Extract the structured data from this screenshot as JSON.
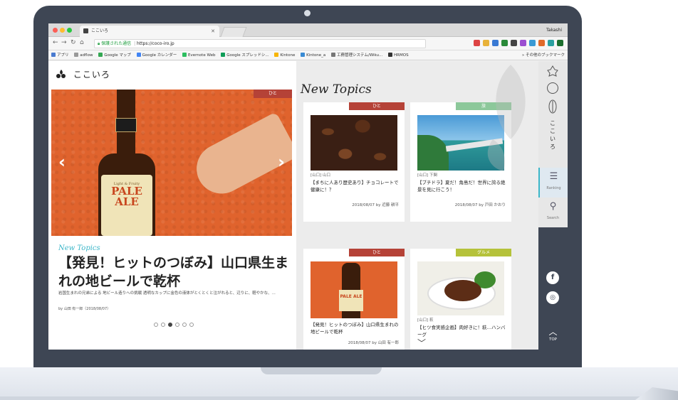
{
  "browser": {
    "tab_title": "ここいろ",
    "username": "Takashi",
    "secure_label": "保護された通信",
    "url": "https://coco-iro.jp",
    "bookmarks": [
      "アプリ",
      "adflow",
      "Google マップ",
      "Google カレンダー",
      "Evernote Web",
      "Google スプレッドシ...",
      "Kintone",
      "Kintone_a",
      "工務管理システム/Wiku...",
      "HRMOS"
    ],
    "other_bookmarks": "その他のブックマーク"
  },
  "site": {
    "logo_text": "ここいろ",
    "nav_vertical": "ここいろ",
    "ranking_label": "Ranking",
    "search_label": "Search",
    "top_label": "TOP",
    "facebook_glyph": "f",
    "instagram_glyph": "◎"
  },
  "hero": {
    "tag": "ひと",
    "bottle_small": "Light & Fruity",
    "bottle_big_1": "PALE",
    "bottle_big_2": "ALE",
    "section_label": "New Topics",
    "title": "【発見！ヒットのつぼみ】山口県生まれの地ビールで乾杯",
    "desc": "岩国生まれの兄弟による 地ビール造りへの挑戦 透明なカップに金色の液体がとくとくと注がれると、辺りに、軽やかな、...",
    "byline": "by 山田 有一郎（2018/08/07）",
    "dots_active_index": 2,
    "dots_count": 6,
    "prev_arrow": "‹",
    "next_arrow": "›"
  },
  "new_topics": {
    "heading": "New Topics",
    "cards": [
      {
        "tag": "ひと",
        "tag_color": "#b54237",
        "meta": "[山口] 山口",
        "title": "【まちに人あり歴史あり】チョコレートで健康に！？",
        "byline": "2018/08/07 by 近藤 耕平"
      },
      {
        "tag": "旅",
        "tag_color": "#8cc89a",
        "meta": "[山口] 下関",
        "title": "【ブチドラ】夏だ！角島だ！世界に誇る絶景を見に行こう！",
        "byline": "2018/08/07 by 戸田 かおり"
      },
      {
        "tag": "ひと",
        "tag_color": "#b54237",
        "meta": "",
        "title": "【発見！ヒットのつぼみ】山口県生まれの地ビールで乾杯",
        "byline": "2018/08/07 by 山田 有一郎",
        "mini_label": "PALE ALE"
      },
      {
        "tag": "グルメ",
        "tag_color": "#b5c23a",
        "meta": "[山口] 萩",
        "title": "【ヒツ食実感企画】肉好きに！萩…ハンバーグ",
        "byline": ""
      }
    ]
  }
}
